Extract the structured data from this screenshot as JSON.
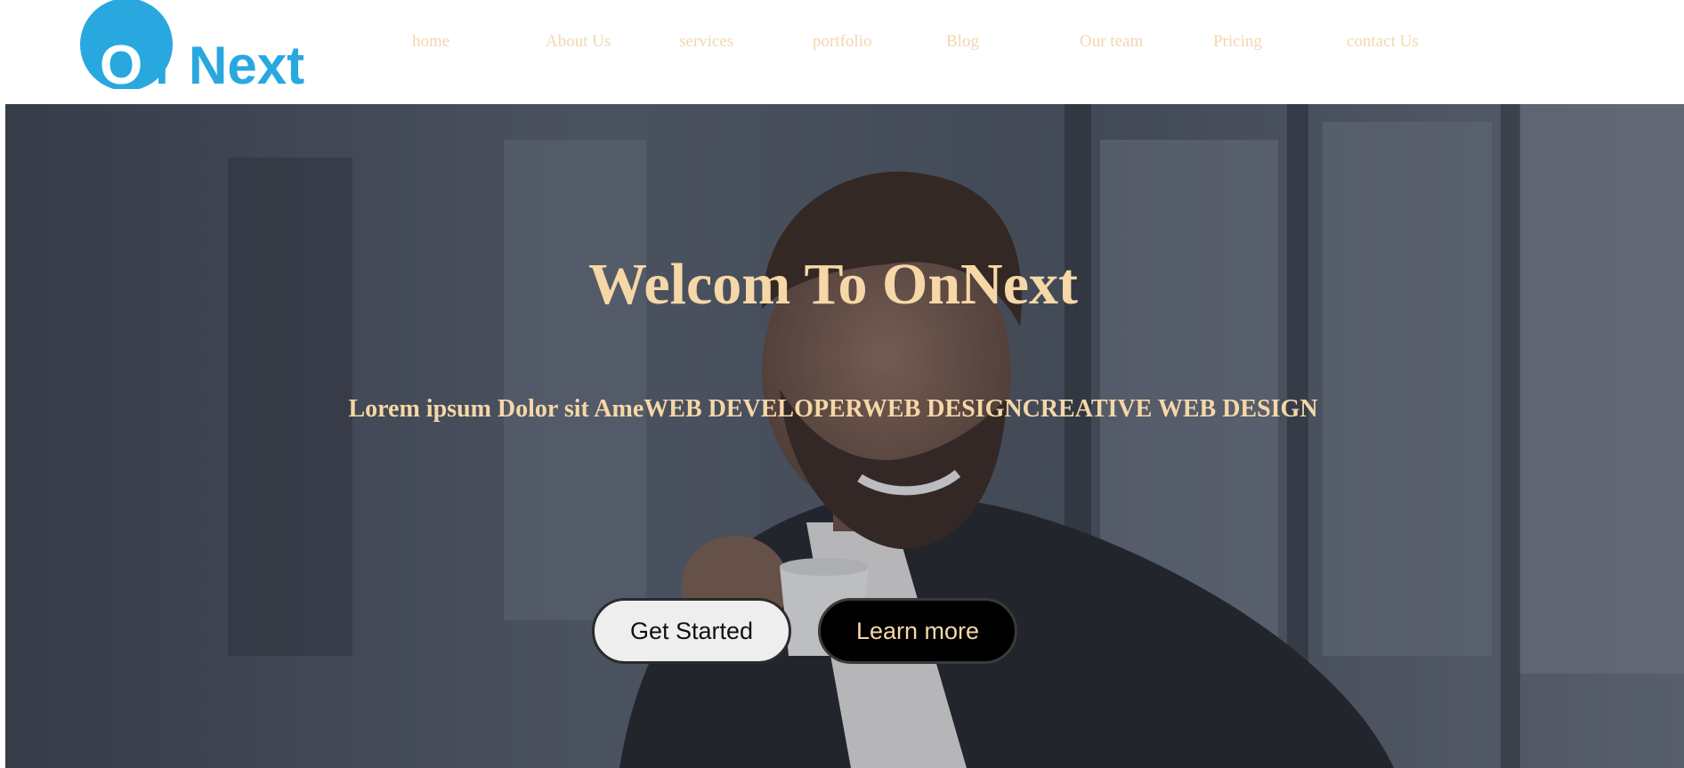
{
  "brand": {
    "logo_text": "OnNext",
    "logo_color": "#29a8e0"
  },
  "nav": {
    "items": [
      {
        "label": "home"
      },
      {
        "label": "About Us"
      },
      {
        "label": "services"
      },
      {
        "label": "portfolio"
      },
      {
        "label": "Blog"
      },
      {
        "label": "Our team"
      },
      {
        "label": "Pricing"
      },
      {
        "label": "contact Us"
      }
    ],
    "text_color": "#f1d7ae"
  },
  "hero": {
    "title": "Welcom To OnNext",
    "subtitle": "Lorem ipsum Dolor sit AmeWEB DEVELOPERWEB DESIGNCREATIVE WEB DESIGN",
    "text_color": "#f6d7a7",
    "buttons": {
      "get_started": "Get Started",
      "learn_more": "Learn more"
    }
  }
}
